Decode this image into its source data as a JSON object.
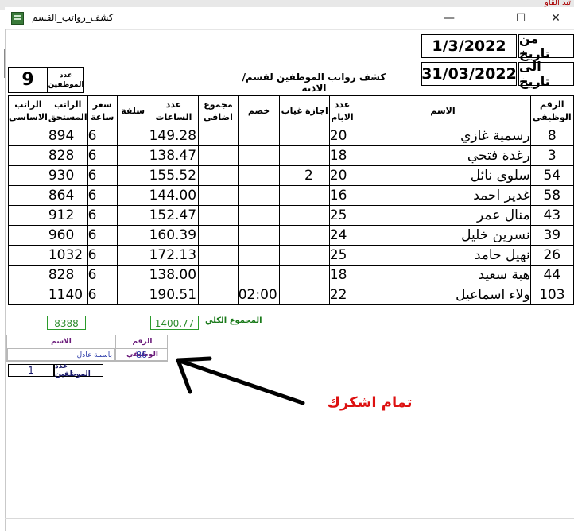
{
  "background_window": {
    "partial_text": "تبد القاو"
  },
  "window": {
    "title": "كشف_رواتب_القسم",
    "minimize": "—",
    "maximize": "☐",
    "close": "✕"
  },
  "header": {
    "from_label": "من تاريخ",
    "from_date": "1/3/2022",
    "to_label": "الى تاريخ",
    "to_date": "31/03/2022",
    "report_title": "كشف رواتب الموظفين لقسم/ الاذنة",
    "employee_count_label": "عدد الموظفين",
    "employee_count": "9"
  },
  "table": {
    "headers": {
      "job_id": "الرقم الوظيفي",
      "name": "الاسم",
      "days": "عدد الايام",
      "leave": "اجازة",
      "absence": "غياب",
      "deduction": "خصم",
      "extra_total": "مجموع اضافي",
      "hours": "عدد الساعات",
      "advance": "سلفة",
      "hourly_rate": "سعر ساعة",
      "due_salary": "الراتب المستحق",
      "base_salary": "الراتب الاساسي"
    },
    "rows": [
      {
        "job_id": "8",
        "name": "رسمية غازي",
        "days": "20",
        "leave": "",
        "absence": "",
        "deduction": "",
        "extra_total": "",
        "hours": "149.28",
        "advance": "",
        "hourly_rate": "6",
        "due_salary": "894",
        "base_salary": ""
      },
      {
        "job_id": "3",
        "name": "رغدة فتحي",
        "days": "18",
        "leave": "",
        "absence": "",
        "deduction": "",
        "extra_total": "",
        "hours": "138.47",
        "advance": "",
        "hourly_rate": "6",
        "due_salary": "828",
        "base_salary": ""
      },
      {
        "job_id": "54",
        "name": "سلوى نائل",
        "days": "20",
        "leave": "2",
        "absence": "",
        "deduction": "",
        "extra_total": "",
        "hours": "155.52",
        "advance": "",
        "hourly_rate": "6",
        "due_salary": "930",
        "base_salary": ""
      },
      {
        "job_id": "58",
        "name": "غدير احمد",
        "days": "16",
        "leave": "",
        "absence": "",
        "deduction": "",
        "extra_total": "",
        "hours": "144.00",
        "advance": "",
        "hourly_rate": "6",
        "due_salary": "864",
        "base_salary": ""
      },
      {
        "job_id": "43",
        "name": "منال عمر",
        "days": "25",
        "leave": "",
        "absence": "",
        "deduction": "",
        "extra_total": "",
        "hours": "152.47",
        "advance": "",
        "hourly_rate": "6",
        "due_salary": "912",
        "base_salary": ""
      },
      {
        "job_id": "39",
        "name": "نسرين خليل",
        "days": "24",
        "leave": "",
        "absence": "",
        "deduction": "",
        "extra_total": "",
        "hours": "160.39",
        "advance": "",
        "hourly_rate": "6",
        "due_salary": "960",
        "base_salary": ""
      },
      {
        "job_id": "26",
        "name": "نهيل حامد",
        "days": "25",
        "leave": "",
        "absence": "",
        "deduction": "",
        "extra_total": "",
        "hours": "172.13",
        "advance": "",
        "hourly_rate": "6",
        "due_salary": "1032",
        "base_salary": ""
      },
      {
        "job_id": "44",
        "name": "هبة سعيد",
        "days": "18",
        "leave": "",
        "absence": "",
        "deduction": "",
        "extra_total": "",
        "hours": "138.00",
        "advance": "",
        "hourly_rate": "6",
        "due_salary": "828",
        "base_salary": ""
      },
      {
        "job_id": "103",
        "name": "ولاء اسماعيل",
        "days": "22",
        "leave": "",
        "absence": "",
        "deduction": "02:00",
        "extra_total": "",
        "hours": "190.51",
        "advance": "",
        "hourly_rate": "6",
        "due_salary": "1140",
        "base_salary": ""
      }
    ]
  },
  "totals": {
    "label": "المجموع الكلي",
    "hours_total": "1400.77",
    "salary_total": "8388"
  },
  "subform": {
    "job_id_header": "الرقم الوظيفي",
    "name_header": "الاسم",
    "job_id_value": "86",
    "name_value": "باسمة عادل",
    "count_label": "عدد الموظفين",
    "count_value": "1"
  },
  "annotation": {
    "text": "تمام اشكرك"
  },
  "colors": {
    "total_green": "#2b9b2b",
    "subform_purple": "#6a1a7a",
    "subform_blue": "#2a3aa8",
    "annotation_red": "#dd1111"
  }
}
